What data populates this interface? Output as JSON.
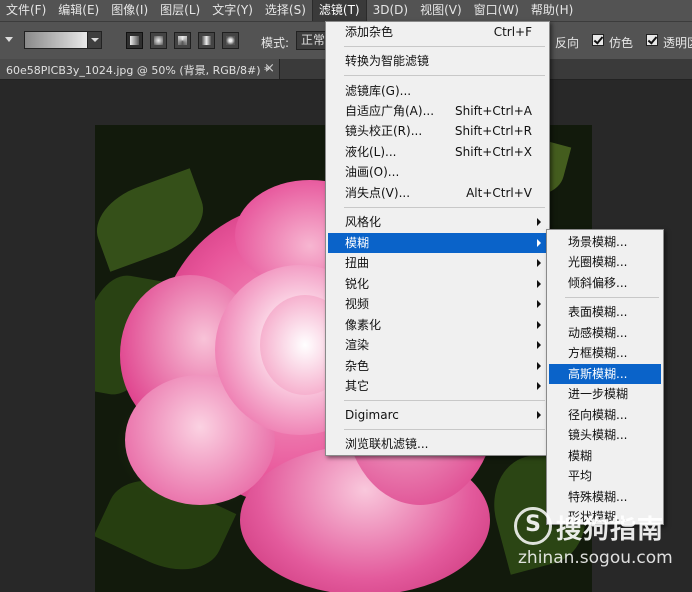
{
  "menubar": {
    "items": [
      {
        "label": "文件(F)"
      },
      {
        "label": "编辑(E)"
      },
      {
        "label": "图像(I)"
      },
      {
        "label": "图层(L)"
      },
      {
        "label": "文字(Y)"
      },
      {
        "label": "选择(S)"
      },
      {
        "label": "滤镜(T)"
      },
      {
        "label": "3D(D)"
      },
      {
        "label": "视图(V)"
      },
      {
        "label": "窗口(W)"
      },
      {
        "label": "帮助(H)"
      }
    ]
  },
  "options_bar": {
    "mode_label": "模式:",
    "mode_value": "正常",
    "reverse_label": "反向",
    "dither_label": "仿色",
    "transparency_label": "透明区",
    "reverse_checked": true,
    "dither_checked": true,
    "transparency_checked": true
  },
  "document_tab": {
    "title": "60e58PICB3y_1024.jpg @ 50% (背景, RGB/8#) *",
    "close": "×"
  },
  "filter_menu": {
    "items": [
      {
        "label": "添加杂色",
        "shortcut": "Ctrl+F"
      },
      {
        "label": "转换为智能滤镜",
        "shortcut": ""
      },
      {
        "label": "滤镜库(G)...",
        "shortcut": ""
      },
      {
        "label": "自适应广角(A)...",
        "shortcut": "Shift+Ctrl+A"
      },
      {
        "label": "镜头校正(R)...",
        "shortcut": "Shift+Ctrl+R"
      },
      {
        "label": "液化(L)...",
        "shortcut": "Shift+Ctrl+X"
      },
      {
        "label": "油画(O)...",
        "shortcut": ""
      },
      {
        "label": "消失点(V)...",
        "shortcut": "Alt+Ctrl+V"
      },
      {
        "label": "风格化",
        "submenu": true
      },
      {
        "label": "模糊",
        "submenu": true,
        "highlighted": true
      },
      {
        "label": "扭曲",
        "submenu": true
      },
      {
        "label": "锐化",
        "submenu": true
      },
      {
        "label": "视频",
        "submenu": true
      },
      {
        "label": "像素化",
        "submenu": true
      },
      {
        "label": "渲染",
        "submenu": true
      },
      {
        "label": "杂色",
        "submenu": true
      },
      {
        "label": "其它",
        "submenu": true
      },
      {
        "label": "Digimarc",
        "submenu": true
      },
      {
        "label": "浏览联机滤镜..."
      }
    ]
  },
  "blur_submenu": {
    "items": [
      {
        "label": "场景模糊..."
      },
      {
        "label": "光圈模糊..."
      },
      {
        "label": "倾斜偏移..."
      },
      {
        "label": "表面模糊..."
      },
      {
        "label": "动感模糊..."
      },
      {
        "label": "方框模糊..."
      },
      {
        "label": "高斯模糊...",
        "highlighted": true
      },
      {
        "label": "进一步模糊"
      },
      {
        "label": "径向模糊..."
      },
      {
        "label": "镜头模糊..."
      },
      {
        "label": "模糊"
      },
      {
        "label": "平均"
      },
      {
        "label": "特殊模糊..."
      },
      {
        "label": "形状模糊..."
      }
    ]
  },
  "watermark": {
    "logo_letter": "S",
    "name": "搜狗指南",
    "url": "zhinan.sogou.com"
  },
  "colors": {
    "accent": "#0a63c9",
    "menu_bg": "#f0f0f0",
    "ui_bg": "#535353",
    "canvas_bg": "#282828"
  }
}
